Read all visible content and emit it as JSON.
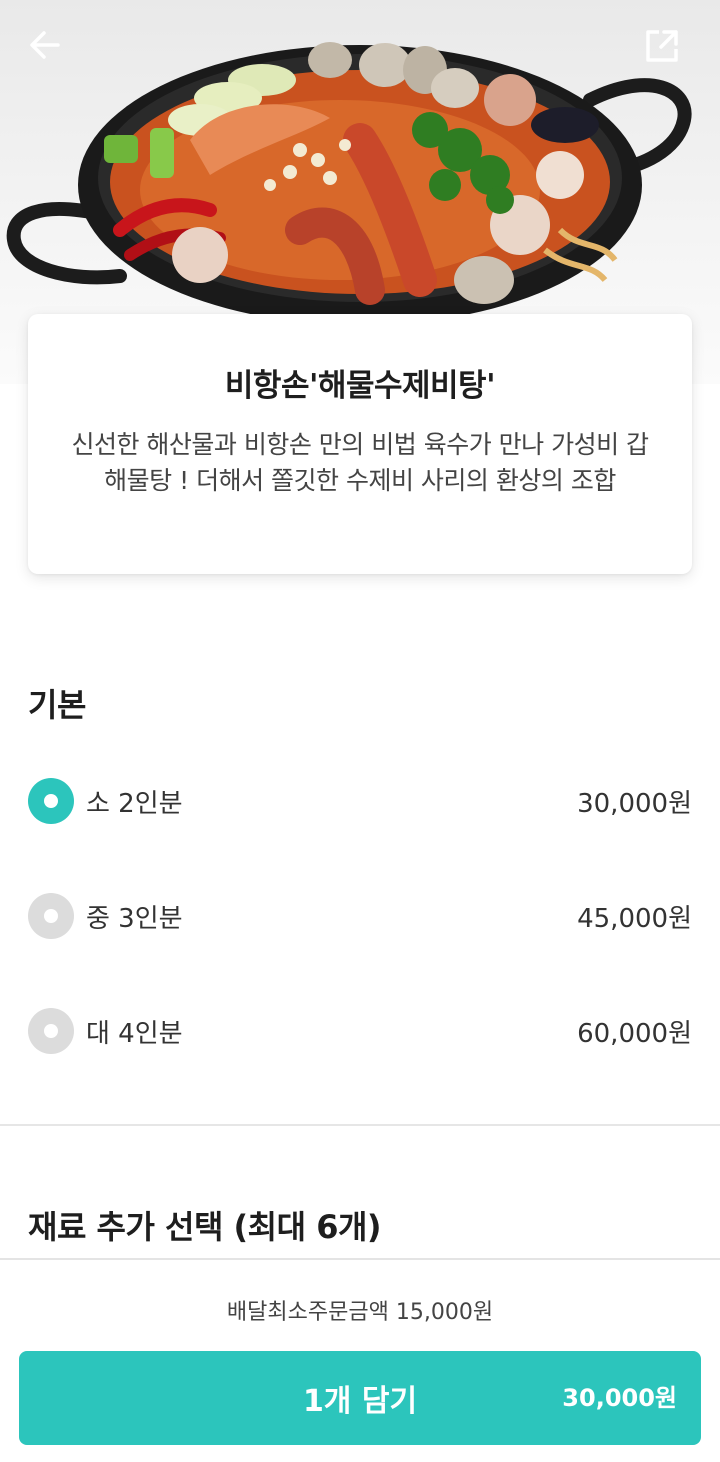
{
  "header": {
    "back_icon": "arrow-left-icon",
    "share_icon": "share-external-icon"
  },
  "menu": {
    "title": "비항손'해물수제비탕'",
    "description": "신선한 해산물과 비항손 만의 비법 육수가 만나 가성비 갑 해물탕 ! 더해서 쫄깃한 수제비 사리의 환상의 조합"
  },
  "basic_section": {
    "title": "기본",
    "options": [
      {
        "label": "소 2인분",
        "price": "30,000원",
        "selected": true
      },
      {
        "label": "중 3인분",
        "price": "45,000원",
        "selected": false
      },
      {
        "label": "대 4인분",
        "price": "60,000원",
        "selected": false
      }
    ]
  },
  "extra_section": {
    "title": "재료 추가 선택 (최대 6개)"
  },
  "footer": {
    "min_order": "배달최소주문금액 15,000원",
    "cart_label": "1개 담기",
    "cart_price": "30,000원"
  },
  "colors": {
    "accent": "#2cc5bc",
    "radio_off": "#dcdcdc"
  }
}
